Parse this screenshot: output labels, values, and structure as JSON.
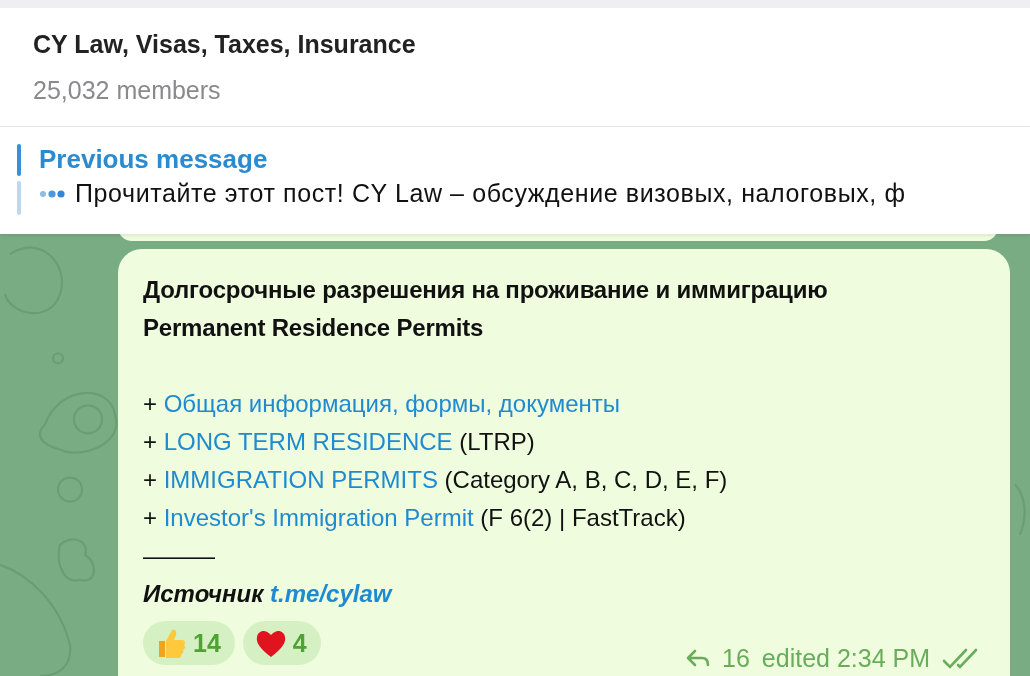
{
  "header": {
    "title": "CY Law, Visas, Taxes, Insurance",
    "members": "25,032 members"
  },
  "pinned": {
    "label": "Previous message",
    "text": "Прочитайте этот пост!  CY Law – обсуждение визовых, налоговых, ф"
  },
  "message": {
    "headings": [
      "Долгосрочные разрешения на проживание и иммиграцию",
      "Permanent Residence Permits"
    ],
    "items": [
      {
        "prefix": "+",
        "link": "Общая информация, формы, документы"
      },
      {
        "prefix": "+",
        "link": "LONG TERM RESIDENCE",
        "suffix": "(LTRP)"
      },
      {
        "prefix": "+",
        "link": "IMMIGRATION PERMITS",
        "suffix": "(Category A, B, C, D, E, F)"
      },
      {
        "prefix": "+",
        "link": "Investor's Immigration Permit",
        "suffix": "(F 6(2) | FastTrack)"
      }
    ],
    "divider": "———",
    "source": {
      "label": "Источник",
      "link": "t.me/cylaw"
    },
    "reactions": [
      {
        "kind": "thumbs-up",
        "count": "14"
      },
      {
        "kind": "heart",
        "count": "4"
      }
    ],
    "replies": "16",
    "status": "edited 2:34 PM",
    "read": true
  }
}
